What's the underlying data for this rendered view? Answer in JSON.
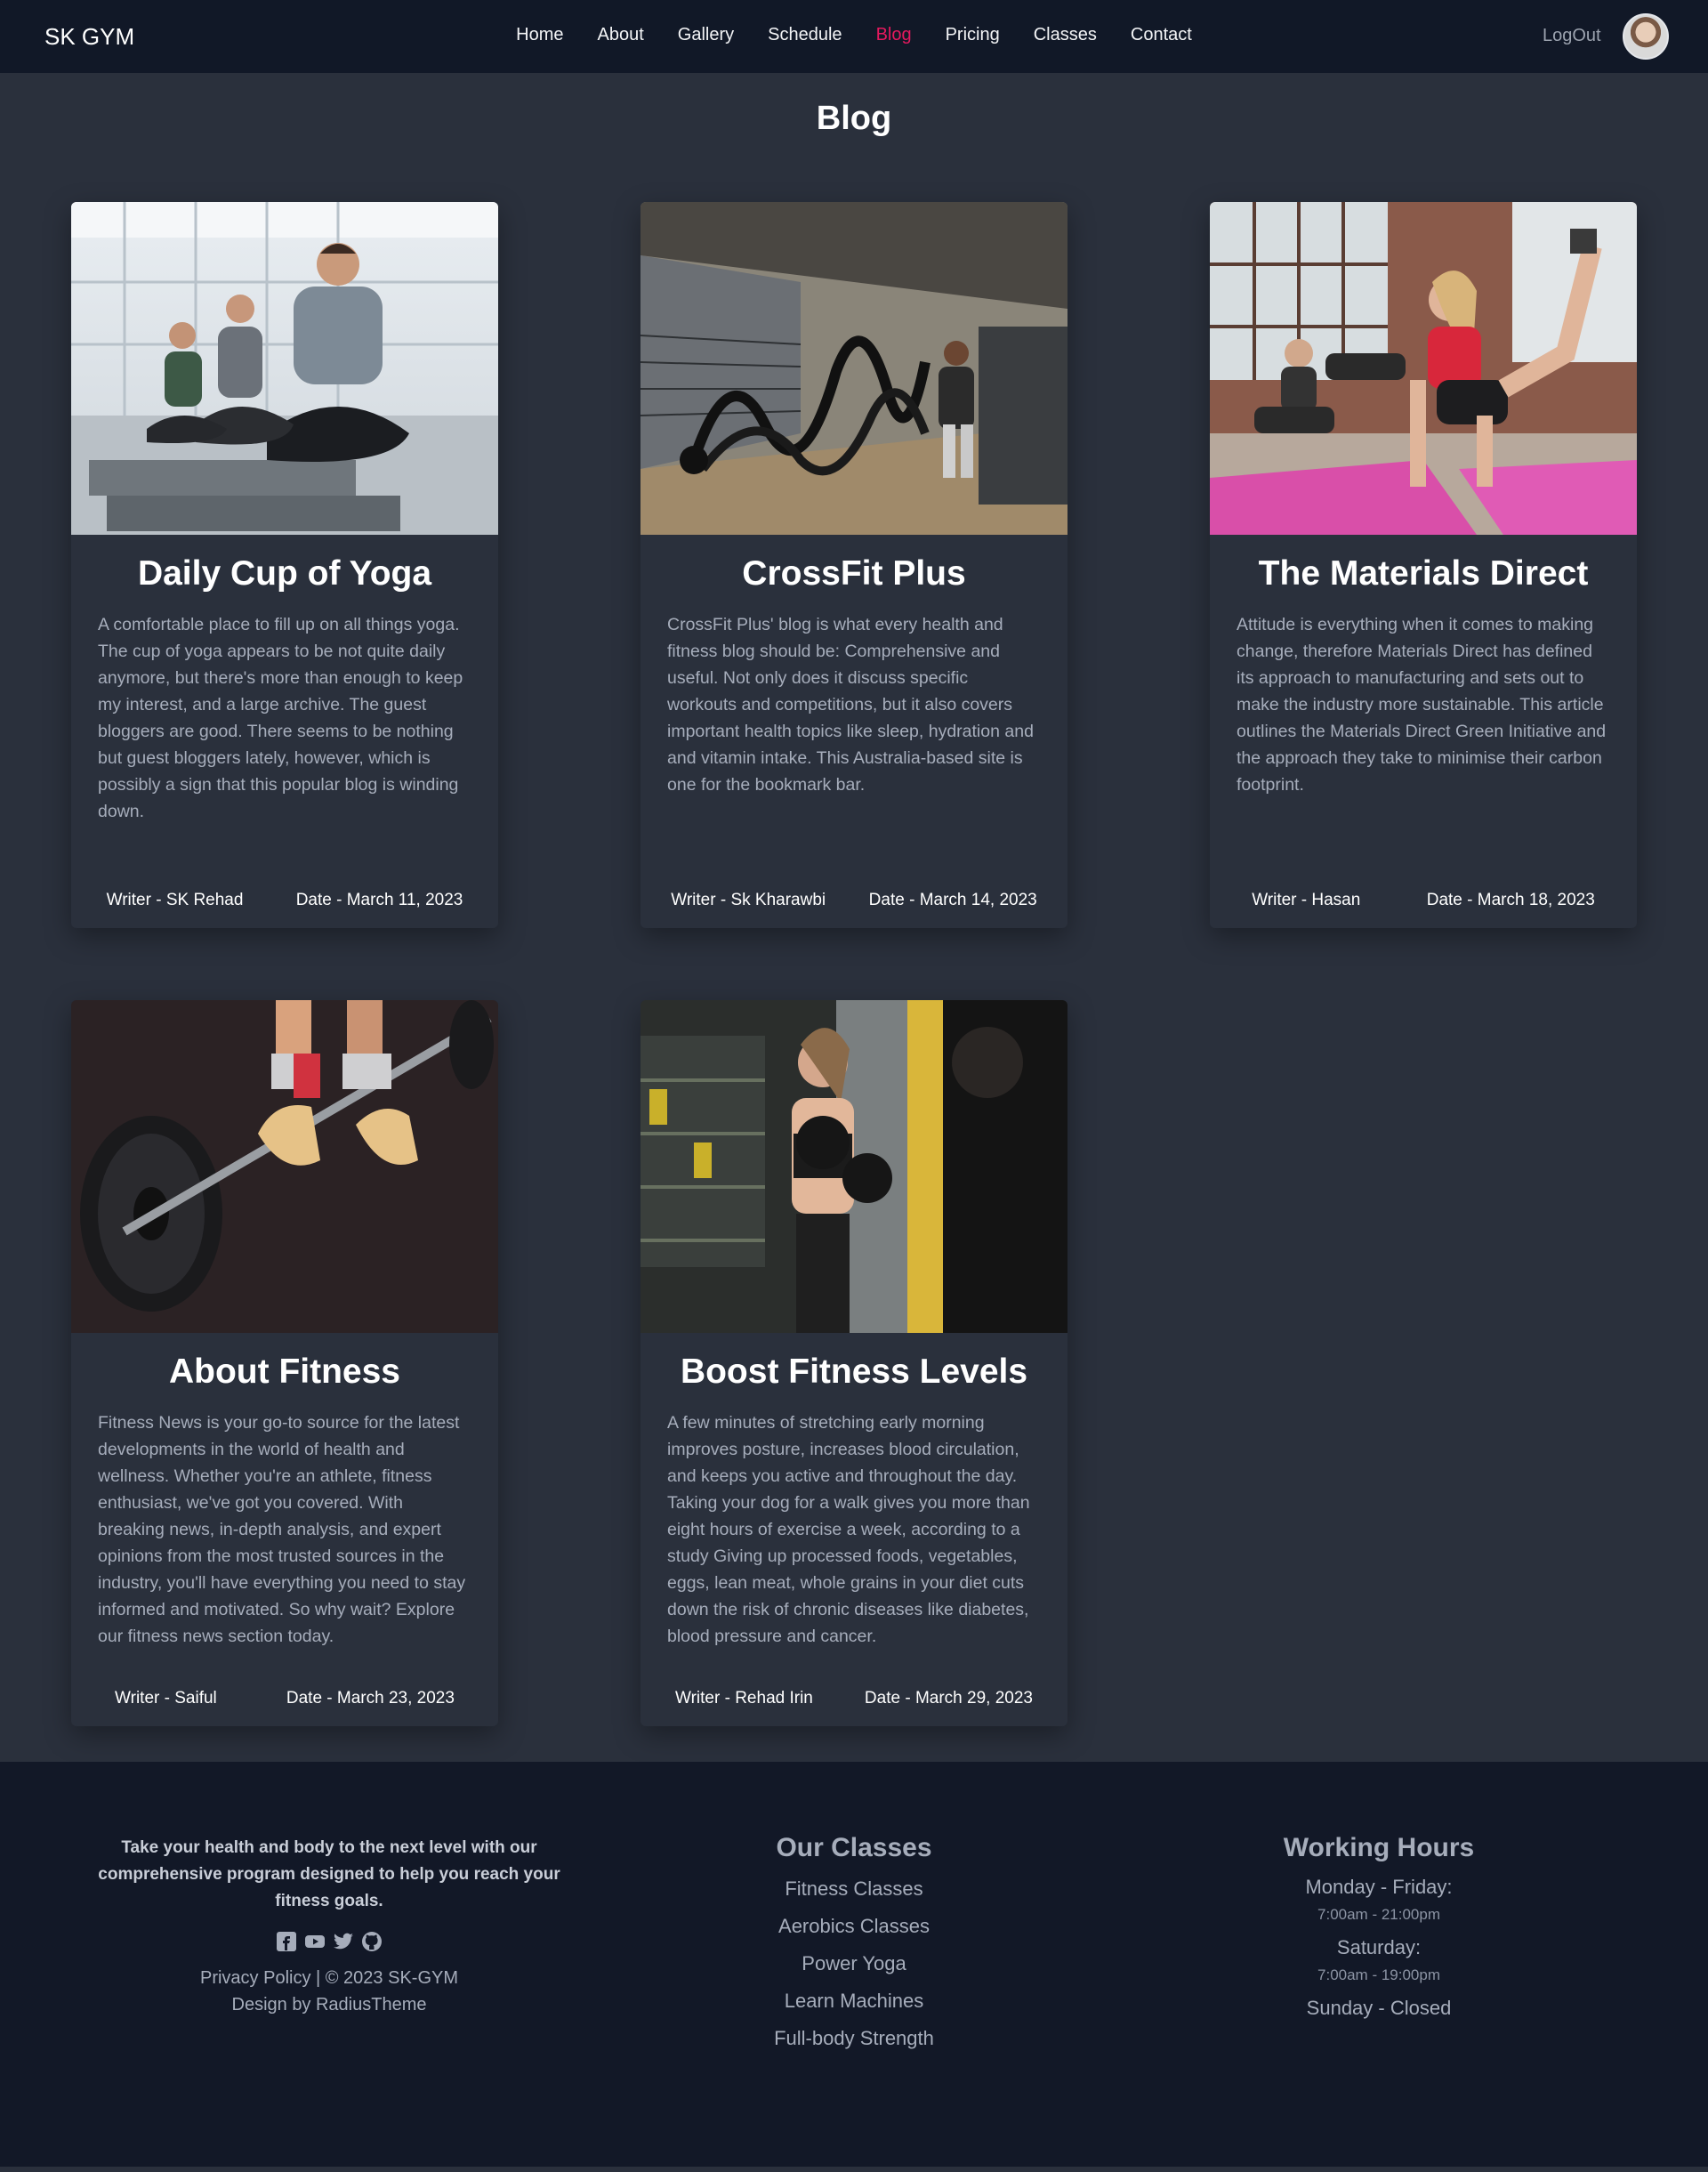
{
  "nav": {
    "brand": "SK GYM",
    "items": [
      "Home",
      "About",
      "Gallery",
      "Schedule",
      "Blog",
      "Pricing",
      "Classes",
      "Contact"
    ],
    "active_index": 4,
    "logout": "LogOut"
  },
  "page": {
    "title": "Blog"
  },
  "cards": [
    {
      "image": "yoga-class-photo",
      "title": "Daily Cup of Yoga",
      "body": "A comfortable place to fill up on all things yoga. The cup of yoga appears to be not quite daily anymore, but there's more than enough to keep my interest, and a large archive. The guest bloggers are good. There seems to be nothing but guest bloggers lately, however, which is possibly a sign that this popular blog is winding down.",
      "writer": "Writer - SK Rehad",
      "date": "Date - March 11, 2023"
    },
    {
      "image": "battle-ropes-photo",
      "title": "CrossFit Plus",
      "body": "CrossFit Plus' blog is what every health and fitness blog should be: Comprehensive and useful. Not only does it discuss specific workouts and competitions, but it also covers important health topics like sleep, hydration and and vitamin intake. This Australia-based site is one for the bookmark bar.",
      "writer": "Writer - Sk Kharawbi",
      "date": "Date - March 14, 2023"
    },
    {
      "image": "mat-exercise-photo",
      "title": "The Materials Direct",
      "body": "Attitude is everything when it comes to making change, therefore Materials Direct has defined its approach to manufacturing and sets out to make the industry more sustainable. This article outlines the Materials Direct Green Initiative and the approach they take to minimise their carbon footprint.",
      "writer": "Writer - Hasan",
      "date": "Date - March 18, 2023"
    },
    {
      "image": "barbell-deadlift-photo",
      "title": "About Fitness",
      "body": "Fitness News is your go-to source for the latest developments in the world of health and wellness. Whether you're an athlete, fitness enthusiast, we've got you covered. With breaking news, in-depth analysis, and expert opinions from the most trusted sources in the industry, you'll have everything you need to stay informed and motivated. So why wait? Explore our fitness news section today.",
      "writer": "Writer - Saiful",
      "date": "Date - March 23, 2023"
    },
    {
      "image": "boxing-training-photo",
      "title": "Boost Fitness Levels",
      "body": "A few minutes of stretching early morning improves posture, increases blood circulation, and keeps you active and throughout the day. Taking your dog for a walk gives you more than eight hours of exercise a week, according to a study Giving up processed foods, vegetables, eggs, lean meat, whole grains in your diet cuts down the risk of chronic diseases like diabetes, blood pressure and cancer.",
      "writer": "Writer - Rehad Irin",
      "date": "Date - March 29, 2023"
    }
  ],
  "footer": {
    "tagline": "Take your health and body to the next level with our comprehensive program designed to help you reach your fitness goals.",
    "social_icons": [
      "facebook-icon",
      "youtube-icon",
      "twitter-icon",
      "github-icon"
    ],
    "legal_line1": "Privacy Policy | © 2023 SK-GYM",
    "legal_line2": "Design by RadiusTheme",
    "classes_heading": "Our Classes",
    "classes": [
      "Fitness Classes",
      "Aerobics Classes",
      "Power Yoga",
      "Learn Machines",
      "Full-body Strength"
    ],
    "hours_heading": "Working Hours",
    "weekday_label": "Monday - Friday:",
    "weekday_time": "7:00am - 21:00pm",
    "saturday_label": "Saturday:",
    "saturday_time": "7:00am - 19:00pm",
    "sunday_label": "Sunday - Closed"
  },
  "colors": {
    "page_bg": "#2a303c",
    "nav_bg": "#111827",
    "footer_bg": "#121827",
    "accent": "#e5195e",
    "muted_text": "#a6adbb"
  }
}
